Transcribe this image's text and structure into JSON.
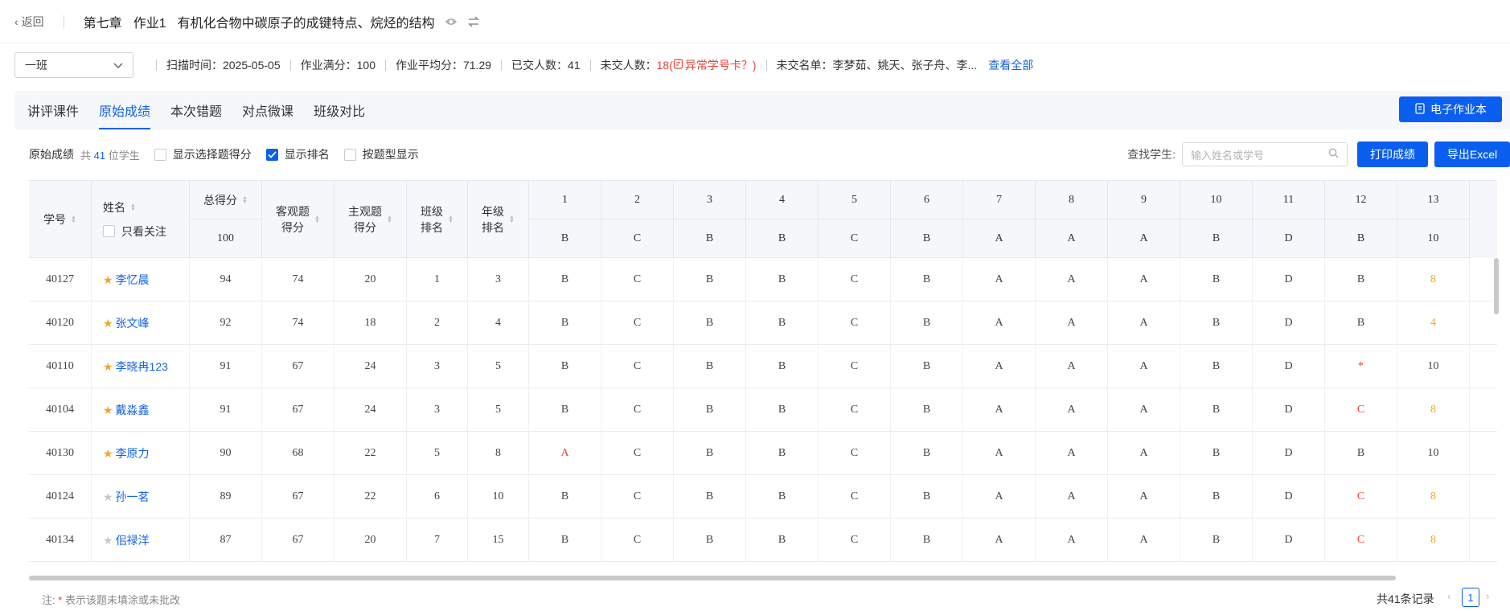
{
  "header": {
    "back_label": "返回",
    "chapter": "第七章",
    "assignment": "作业1",
    "title": "有机化合物中碳原子的成键特点、烷烃的结构"
  },
  "info": {
    "class_select": "一班",
    "scan_time_label": "扫描时间：",
    "scan_time": "2025-05-05",
    "full_score_label": "作业满分：",
    "full_score": "100",
    "avg_label": "作业平均分：",
    "avg": "71.29",
    "submitted_label": "已交人数：",
    "submitted": "41",
    "unsubmitted_label": "未交人数：",
    "unsubmitted": "18",
    "abnormal_link": "异常学号卡？",
    "unsubmitted_list_label": "未交名单：",
    "unsubmitted_list": "李梦茹、姚天、张子舟、李...",
    "view_all": "查看全部"
  },
  "tabs": [
    "讲评课件",
    "原始成绩",
    "本次错题",
    "对点微课",
    "班级对比"
  ],
  "active_tab": 1,
  "e_homework_btn": "电子作业本",
  "controls": {
    "label": "原始成绩",
    "count_prefix": "共",
    "count": "41",
    "count_suffix": "位学生",
    "cb_choice": "显示选择题得分",
    "cb_rank": "显示排名",
    "cb_type": "按题型显示",
    "search_label": "查找学生:",
    "search_placeholder": "输入姓名或学号",
    "print_btn": "打印成绩",
    "export_btn": "导出Excel"
  },
  "table": {
    "h_id": "学号",
    "h_name": "姓名",
    "h_follow": "只看关注",
    "h_total": "总得分",
    "total_full": "100",
    "h_objective": [
      "客观题",
      "得分"
    ],
    "h_subjective": [
      "主观题",
      "得分"
    ],
    "h_class_rank": [
      "班级",
      "排名"
    ],
    "h_grade_rank": [
      "年级",
      "排名"
    ],
    "questions": [
      "1",
      "2",
      "3",
      "4",
      "5",
      "6",
      "7",
      "8",
      "9",
      "10",
      "11",
      "12",
      "13"
    ],
    "answers": [
      "B",
      "C",
      "B",
      "B",
      "C",
      "B",
      "A",
      "A",
      "A",
      "B",
      "D",
      "B",
      "10"
    ],
    "rows": [
      {
        "id": "40127",
        "name": "李忆晨",
        "fav": true,
        "total": "94",
        "obj": "74",
        "sub": "20",
        "crank": "1",
        "grank": "3",
        "ans": [
          "B",
          "C",
          "B",
          "B",
          "C",
          "B",
          "A",
          "A",
          "A",
          "B",
          "D",
          "B",
          "8"
        ],
        "wrong": [
          12
        ]
      },
      {
        "id": "40120",
        "name": "张文峰",
        "fav": true,
        "total": "92",
        "obj": "74",
        "sub": "18",
        "crank": "2",
        "grank": "4",
        "ans": [
          "B",
          "C",
          "B",
          "B",
          "C",
          "B",
          "A",
          "A",
          "A",
          "B",
          "D",
          "B",
          "4"
        ],
        "wrong": [
          12
        ]
      },
      {
        "id": "40110",
        "name": "李晓冉123",
        "fav": true,
        "total": "91",
        "obj": "67",
        "sub": "24",
        "crank": "3",
        "grank": "5",
        "ans": [
          "B",
          "C",
          "B",
          "B",
          "C",
          "B",
          "A",
          "A",
          "A",
          "B",
          "D",
          "*",
          "10"
        ],
        "wrong": [
          11
        ]
      },
      {
        "id": "40104",
        "name": "戴淼鑫",
        "fav": true,
        "total": "91",
        "obj": "67",
        "sub": "24",
        "crank": "3",
        "grank": "5",
        "ans": [
          "B",
          "C",
          "B",
          "B",
          "C",
          "B",
          "A",
          "A",
          "A",
          "B",
          "D",
          "C",
          "8"
        ],
        "wrong": [
          11,
          12
        ]
      },
      {
        "id": "40130",
        "name": "李原力",
        "fav": true,
        "total": "90",
        "obj": "68",
        "sub": "22",
        "crank": "5",
        "grank": "8",
        "ans": [
          "A",
          "C",
          "B",
          "B",
          "C",
          "B",
          "A",
          "A",
          "A",
          "B",
          "D",
          "B",
          "10"
        ],
        "wrong": [
          0
        ]
      },
      {
        "id": "40124",
        "name": "孙一茗",
        "fav": false,
        "total": "89",
        "obj": "67",
        "sub": "22",
        "crank": "6",
        "grank": "10",
        "ans": [
          "B",
          "C",
          "B",
          "B",
          "C",
          "B",
          "A",
          "A",
          "A",
          "B",
          "D",
          "C",
          "8"
        ],
        "wrong": [
          11,
          12
        ]
      },
      {
        "id": "40134",
        "name": "佀禄洋",
        "fav": false,
        "total": "87",
        "obj": "67",
        "sub": "20",
        "crank": "7",
        "grank": "15",
        "ans": [
          "B",
          "C",
          "B",
          "B",
          "C",
          "B",
          "A",
          "A",
          "A",
          "B",
          "D",
          "C",
          "8"
        ],
        "wrong": [
          11,
          12
        ]
      }
    ]
  },
  "footer": {
    "note_prefix": "注:",
    "note_star": "*",
    "note_text": "表示该题未填涂或未批改",
    "total_records": "共41条记录",
    "page": "1"
  },
  "colors": {
    "primary": "#0b5ff0",
    "link": "#1463e6",
    "error": "#f04134",
    "partial": "#f5a623",
    "star_on": "#f5a623",
    "star_off": "#c4c8cf"
  }
}
